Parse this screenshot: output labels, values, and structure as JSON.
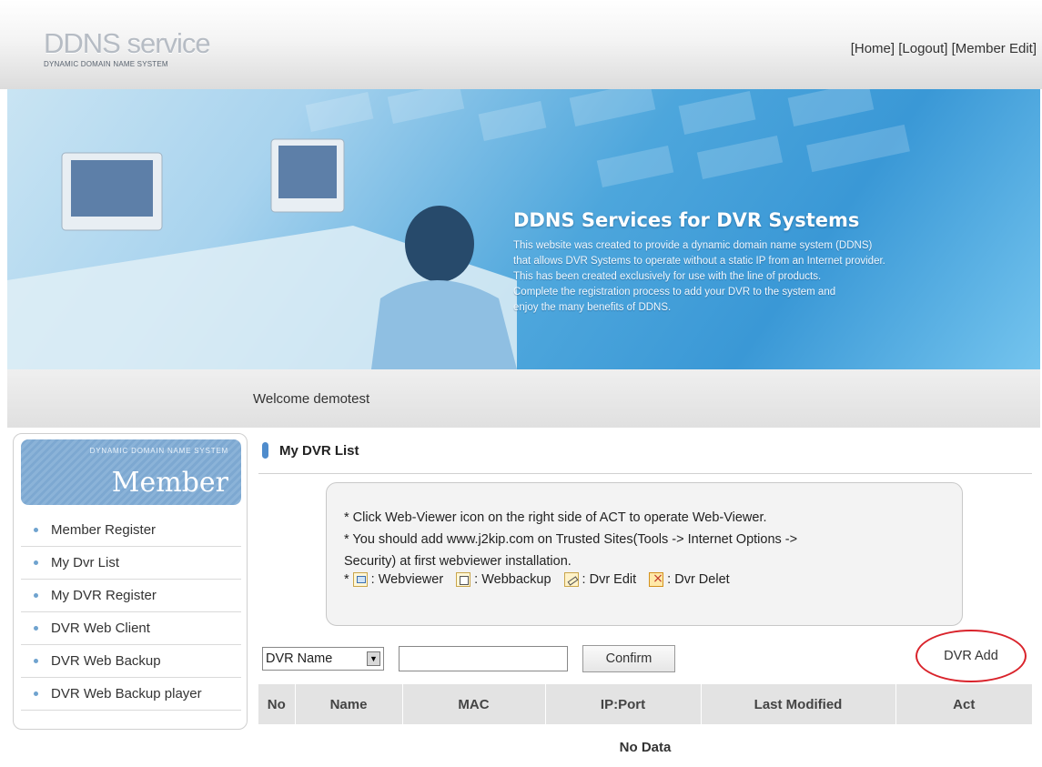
{
  "header": {
    "logo_title": "DDNS service",
    "logo_subtitle": "DYNAMIC DOMAIN NAME SYSTEM",
    "links": [
      "[Home]",
      "[Logout]",
      "[Member Edit]"
    ]
  },
  "banner": {
    "title": "DDNS Services for DVR Systems",
    "lines": [
      "This website was created to provide a dynamic domain name system (DDNS)",
      "that allows DVR Systems to operate without a static IP from an Internet provider.",
      "This has been created exclusively for use with the line of products.",
      "Complete the registration process to add your DVR to the system and",
      "enjoy the many benefits of DDNS."
    ]
  },
  "welcome": "Welcome demotest",
  "sidebar": {
    "box_subtitle": "DYNAMIC DOMAIN NAME SYSTEM",
    "box_title": "Member",
    "items": [
      {
        "label": "Member Register"
      },
      {
        "label": "My Dvr List"
      },
      {
        "label": "My DVR Register"
      },
      {
        "label": "DVR Web Client"
      },
      {
        "label": "DVR Web Backup"
      },
      {
        "label": "DVR Web Backup player"
      }
    ]
  },
  "main": {
    "title": "My DVR List",
    "info": [
      "* Click Web-Viewer icon on the right side of ACT to operate Web-Viewer.",
      "* You should add www.j2kip.com on Trusted Sites(Tools -> Internet Options ->",
      "Security) at first webviewer installation."
    ],
    "legend": {
      "prefix": "*",
      "webviewer": ": Webviewer",
      "webbackup": ": Webbackup",
      "edit": ": Dvr Edit",
      "delete": ": Dvr Delet"
    },
    "search": {
      "select_value": "DVR Name",
      "input_value": "",
      "confirm_label": "Confirm"
    },
    "add_label": "DVR Add",
    "table": {
      "columns": [
        "No",
        "Name",
        "MAC",
        "IP:Port",
        "Last Modified",
        "Act"
      ],
      "empty_text": "No Data"
    }
  }
}
